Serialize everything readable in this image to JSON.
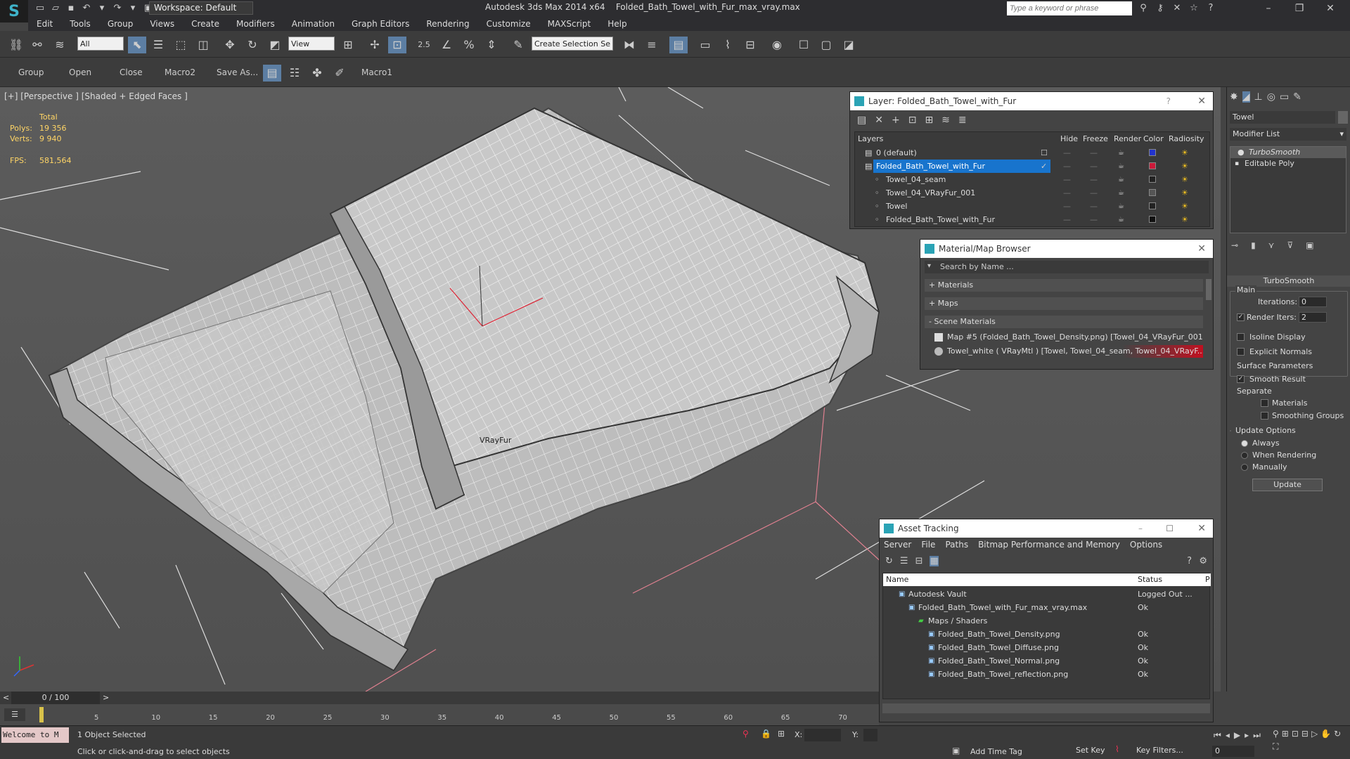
{
  "titlebar": {
    "workspace": "Workspace: Default",
    "app": "Autodesk 3ds Max  2014 x64",
    "file": "Folded_Bath_Towel_with_Fur_max_vray.max",
    "search_placeholder": "Type a keyword or phrase"
  },
  "menu": [
    "Edit",
    "Tools",
    "Group",
    "Views",
    "Create",
    "Modifiers",
    "Animation",
    "Graph Editors",
    "Rendering",
    "Customize",
    "MAXScript",
    "Help"
  ],
  "toolbar": {
    "filter": "All",
    "ref_coord": "View",
    "selection_set": "Create Selection Se",
    "snap_value": "2.5"
  },
  "toolbar2": [
    "Group",
    "Open",
    "Close",
    "Macro2",
    "Save As...",
    "Macro1"
  ],
  "viewport": {
    "label": "[+] [Perspective ] [Shaded + Edged Faces ]",
    "stats_total": "Total",
    "polys_label": "Polys:",
    "polys": "19 356",
    "verts_label": "Verts:",
    "verts": "9 940",
    "fps_label": "FPS:",
    "fps": "581,564",
    "vrayfur": "VRayFur"
  },
  "layer_panel": {
    "title": "Layer: Folded_Bath_Towel_with_Fur",
    "headers": [
      "Layers",
      "Hide",
      "Freeze",
      "Render",
      "Color",
      "Radiosity"
    ],
    "rows": [
      {
        "name": "0 (default)",
        "color": "#2233cc",
        "selected": false,
        "indent": 0
      },
      {
        "name": "Folded_Bath_Towel_with_Fur",
        "color": "#cc1a3a",
        "selected": true,
        "indent": 0
      },
      {
        "name": "Towel_04_seam",
        "color": "#222222",
        "selected": false,
        "indent": 1
      },
      {
        "name": "Towel_04_VRayFur_001",
        "color": "#555555",
        "selected": false,
        "indent": 1
      },
      {
        "name": "Towel",
        "color": "#222222",
        "selected": false,
        "indent": 1
      },
      {
        "name": "Folded_Bath_Towel_with_Fur",
        "color": "#111111",
        "selected": false,
        "indent": 1
      }
    ]
  },
  "material_browser": {
    "title": "Material/Map Browser",
    "search_placeholder": "Search by Name ...",
    "sections": [
      "+ Materials",
      "+ Maps",
      "- Scene Materials"
    ],
    "items": [
      "Map #5 (Folded_Bath_Towel_Density.png) [Towel_04_VRayFur_001]",
      "Towel_white  ( VRayMtl ) [Towel, Towel_04_seam, Towel_04_VRayF..."
    ]
  },
  "asset_tracking": {
    "title": "Asset Tracking",
    "menu": [
      "Server",
      "File",
      "Paths",
      "Bitmap Performance and Memory",
      "Options"
    ],
    "headers": [
      "Name",
      "Status",
      "P"
    ],
    "rows": [
      {
        "name": "Autodesk Vault",
        "status": "Logged Out ...",
        "indent": 1
      },
      {
        "name": "Folded_Bath_Towel_with_Fur_max_vray.max",
        "status": "Ok",
        "indent": 2
      },
      {
        "name": "Maps / Shaders",
        "status": "",
        "indent": 3
      },
      {
        "name": "Folded_Bath_Towel_Density.png",
        "status": "Ok",
        "indent": 4
      },
      {
        "name": "Folded_Bath_Towel_Diffuse.png",
        "status": "Ok",
        "indent": 4
      },
      {
        "name": "Folded_Bath_Towel_Normal.png",
        "status": "Ok",
        "indent": 4
      },
      {
        "name": "Folded_Bath_Towel_reflection.png",
        "status": "Ok",
        "indent": 4
      }
    ]
  },
  "command_panel": {
    "object_name": "Towel",
    "modifier_list": "Modifier List",
    "stack": [
      "TurboSmooth",
      "Editable Poly"
    ],
    "rollout": "TurboSmooth",
    "main": "Main",
    "iterations_label": "Iterations:",
    "iterations": "0",
    "render_iters_label": "Render Iters:",
    "render_iters": "2",
    "isoline": "Isoline Display",
    "explicit": "Explicit Normals",
    "surface_params": "Surface Parameters",
    "smooth_result": "Smooth Result",
    "separate": "Separate",
    "materials": "Materials",
    "smoothing_groups": "Smoothing Groups",
    "update_options": "Update Options",
    "always": "Always",
    "when_rendering": "When Rendering",
    "manually": "Manually",
    "update": "Update"
  },
  "timeline": {
    "frame": "0 / 100",
    "ticks": [
      "5",
      "10",
      "15",
      "20",
      "25",
      "30",
      "35",
      "40",
      "45",
      "50",
      "55",
      "60",
      "65",
      "70"
    ]
  },
  "status": {
    "welcome": "Welcome to M",
    "selected": "1 Object Selected",
    "prompt": "Click or click-and-drag to select objects",
    "x_label": "X:",
    "y_label": "Y:",
    "add_time_tag": "Add Time Tag",
    "set_key": "Set Key",
    "key_filters": "Key Filters...",
    "frame_value": "0"
  }
}
